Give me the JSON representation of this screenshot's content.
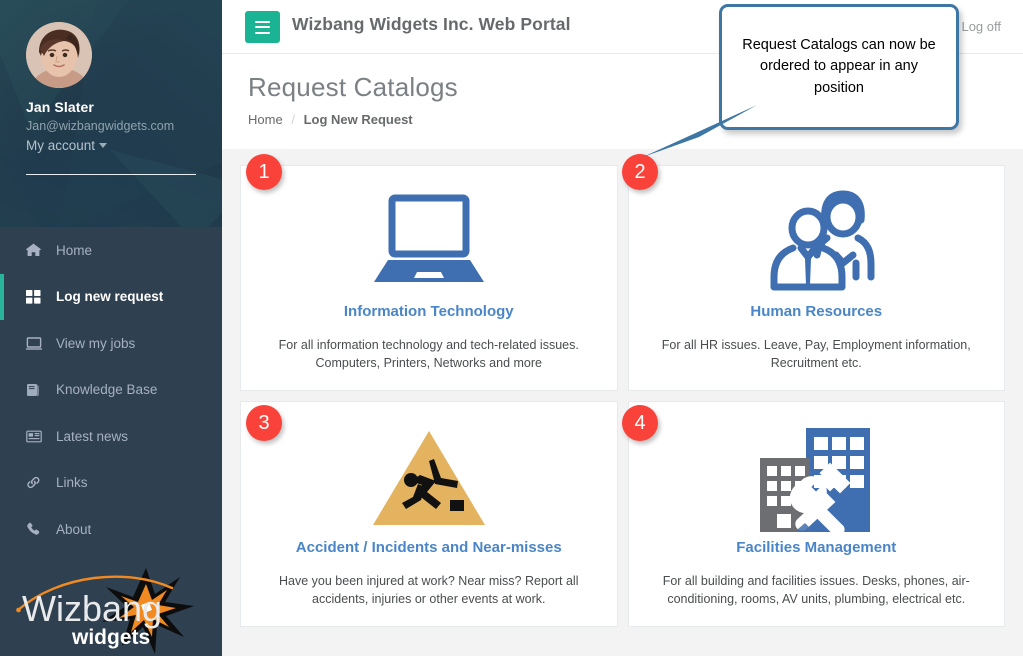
{
  "sidebar": {
    "profile": {
      "name": "Jan Slater",
      "email": "Jan@wizbangwidgets.com",
      "account_menu": "My account"
    },
    "items": [
      {
        "label": "Home",
        "icon": "home-icon",
        "active": false
      },
      {
        "label": "Log new request",
        "icon": "grid-icon",
        "active": true
      },
      {
        "label": "View my jobs",
        "icon": "monitor-icon",
        "active": false
      },
      {
        "label": "Knowledge Base",
        "icon": "book-icon",
        "active": false
      },
      {
        "label": "Latest news",
        "icon": "newspaper-icon",
        "active": false
      },
      {
        "label": "Links",
        "icon": "link-icon",
        "active": false
      },
      {
        "label": "About",
        "icon": "phone-icon",
        "active": false
      }
    ],
    "logo": {
      "primary": "Wizbang",
      "secondary": "widgets"
    },
    "colors": {
      "background": "#2f4050",
      "profile_background": "#20394b",
      "active_marker": "#2ab59a"
    }
  },
  "topbar": {
    "title": "Wizbang Widgets Inc. Web Portal",
    "logoff_label": "Log off",
    "hamburger_color": "#1ab394"
  },
  "page": {
    "title": "Request Catalogs",
    "breadcrumb": {
      "home": "Home",
      "separator": "/",
      "current": "Log New Request"
    }
  },
  "callout": {
    "text": "Request Catalogs can now be ordered to appear in any position",
    "border_color": "#3e76a4"
  },
  "badges": [
    {
      "number": "1"
    },
    {
      "number": "2"
    },
    {
      "number": "3"
    },
    {
      "number": "4"
    }
  ],
  "catalogs": [
    {
      "title": "Information Technology",
      "description": "For all information technology and tech-related issues. Computers, Printers, Networks and more",
      "icon": "laptop-icon"
    },
    {
      "title": "Human Resources",
      "description": "For all HR issues. Leave, Pay, Employment information, Recruitment etc.",
      "icon": "people-icon"
    },
    {
      "title": "Accident / Incidents and Near-misses",
      "description": "Have you been injured at work? Near miss? Report all accidents, injuries or other events at work.",
      "icon": "slip-hazard-icon"
    },
    {
      "title": "Facilities Management",
      "description": "For all building and facilities issues. Desks, phones, air-conditioning, rooms, AV units, plumbing, electrical etc.",
      "icon": "buildings-tools-icon"
    }
  ],
  "colors": {
    "card_title": "#4a86c7",
    "badge": "#f9423a",
    "page_background": "#f3f3f4",
    "icon_blue": "#3f6fb0",
    "icon_amber": "#e3b35f",
    "icon_grey": "#6d6e71"
  }
}
